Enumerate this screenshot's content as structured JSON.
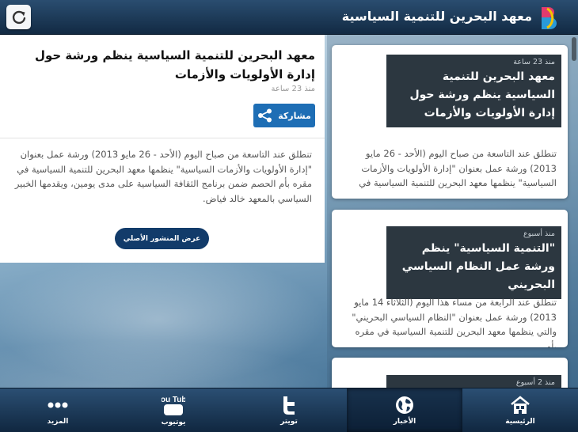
{
  "header": {
    "title": "معهد البحرين للتنمية السياسية",
    "refresh_icon": "refresh-icon",
    "logo_icon": "bdi-logo-icon",
    "colors": {
      "bar": "#1a3655",
      "accent": "#1e6eb5"
    }
  },
  "detail": {
    "title": "معهد البحرين للتنمية السياسية ينظم ورشة حول إدارة الأولويات والأزمات",
    "time": "منذ 23 ساعة",
    "share_label": "مشاركة",
    "body": "تنطلق عند التاسعة من صباح اليوم (الأحد - 26 مايو 2013) ورشة عمل بعنوان \"إدارة الأولويات والأزمات السياسية\" ينظمها معهد البحرين للتنمية السياسية في مقره بأم الحصم ضمن برنامج الثقافة السياسية على مدى يومين، ويقدمها الخبير السياسي بالمعهد خالد فياض.",
    "original_label": "عرض المنشور الأصلي"
  },
  "news": [
    {
      "time": "منذ 23 ساعة",
      "title": "معهد البحرين للتنمية السياسية ينظم ورشة حول إدارة الأولويات والأزمات",
      "excerpt": "تنطلق عند التاسعة من صباح اليوم (الأحد - 26 مايو 2013) ورشة عمل بعنوان \"إدارة الأولويات والأزمات السياسية\" ينظمها معهد البحرين للتنمية السياسية في"
    },
    {
      "time": "منذ أسبوع",
      "title": "\"التنمية السياسية\" ينظم ورشة عمل النظام السياسي البحريني",
      "excerpt": "تنطلق عند الرابعة من مساء هذا اليوم (الثلاثاء 14 مايو 2013) ورشة عمل بعنوان \"النظام السياسي البحريني\" والتي ينظمها معهد البحرين للتنمية السياسية في مقره بأم"
    },
    {
      "time": "منذ 2 أسبوع"
    }
  ],
  "tabs": [
    {
      "label": "الرئيسية",
      "icon": "home-icon",
      "active": false
    },
    {
      "label": "الأخبار",
      "icon": "globe-icon",
      "active": true
    },
    {
      "label": "تويتر",
      "icon": "twitter-icon",
      "active": false
    },
    {
      "label": "يوتيوب",
      "icon": "youtube-icon",
      "icon_text": "You Tube",
      "active": false
    },
    {
      "label": "المزيد",
      "icon": "more-icon",
      "active": false
    }
  ]
}
